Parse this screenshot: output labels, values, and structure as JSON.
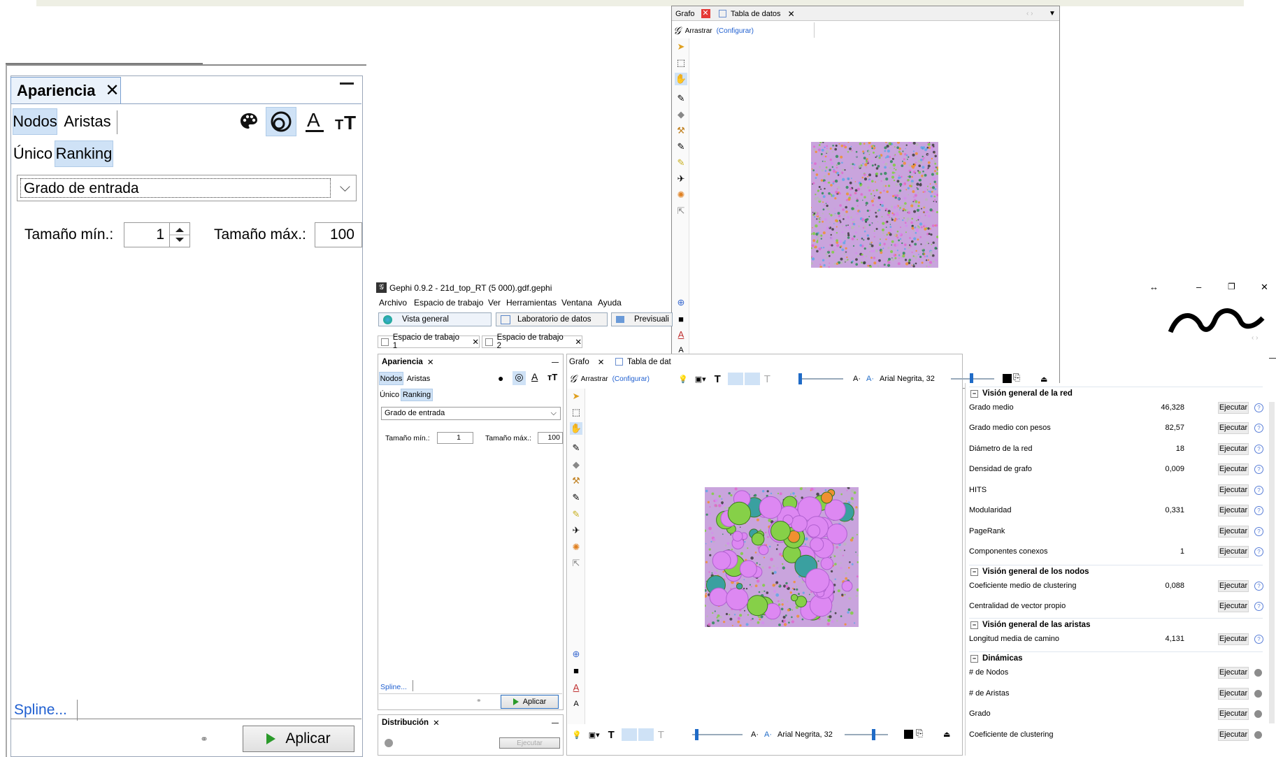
{
  "zoomed_panel": {
    "tab_title": "Apariencia",
    "close": "✕",
    "seg_nodes": "Nodos",
    "seg_edges": "Aristas",
    "mode_unique": "Único",
    "mode_ranking": "Ranking",
    "attribute": "Grado de entrada",
    "min_label": "Tamaño mín.:",
    "min_value": "1",
    "max_label": "Tamaño máx.:",
    "max_value": "100",
    "spline": "Spline...",
    "apply": "Aplicar"
  },
  "float_window": {
    "tab_graph": "Grafo",
    "tab_table": "Tabla de datos",
    "drag_label": "Arrastrar",
    "configure": "(Configurar)"
  },
  "main_window": {
    "title": "Gephi 0.9.2 - 21d_top_RT (5 000).gdf.gephi",
    "menu": [
      "Archivo",
      "Espacio de trabajo",
      "Ver",
      "Herramientas",
      "Ventana",
      "Ayuda"
    ],
    "nav": [
      "Vista general",
      "Laboratorio de datos",
      "Previsuali"
    ],
    "workspaces": [
      "Espacio de trabajo 1",
      "Espacio de trabajo 2"
    ],
    "appearance": {
      "tab_title": "Apariencia",
      "seg_nodes": "Nodos",
      "seg_edges": "Aristas",
      "mode_unique": "Único",
      "mode_ranking": "Ranking",
      "attribute": "Grado de entrada",
      "min_label": "Tamaño mín.:",
      "min_value": "1",
      "max_label": "Tamaño máx.:",
      "max_value": "100",
      "spline": "Spline...",
      "apply": "Aplicar"
    },
    "distribution": {
      "tab_title": "Distribución",
      "run": "Ejecutar"
    },
    "graph_tabs": {
      "graph": "Grafo",
      "table": "Tabla de dat"
    },
    "graph_toolbar": {
      "drag_label": "Arrastrar",
      "configure": "(Configurar)",
      "font": "Arial Negrita, 32"
    },
    "stats": {
      "sections": [
        {
          "title": "Visión general de la red"
        },
        {
          "title": "Visión general de los nodos"
        },
        {
          "title": "Visión general de las aristas"
        },
        {
          "title": "Dinámicas"
        }
      ],
      "run_label": "Ejecutar",
      "rows_network": [
        {
          "name": "Grado medio",
          "value": "46,328"
        },
        {
          "name": "Grado medio con pesos",
          "value": "82,57"
        },
        {
          "name": "Diámetro de la red",
          "value": "18"
        },
        {
          "name": "Densidad de grafo",
          "value": "0,009"
        },
        {
          "name": "HITS",
          "value": ""
        },
        {
          "name": "Modularidad",
          "value": "0,331"
        },
        {
          "name": "PageRank",
          "value": ""
        },
        {
          "name": "Componentes conexos",
          "value": "1"
        }
      ],
      "rows_nodes": [
        {
          "name": "Coeficiente medio de clustering",
          "value": "0,088"
        },
        {
          "name": "Centralidad de vector propio",
          "value": ""
        }
      ],
      "rows_edges": [
        {
          "name": "Longitud media de camino",
          "value": "4,131"
        }
      ],
      "rows_dynamic": [
        {
          "name": "# de Nodos",
          "value": ""
        },
        {
          "name": "# de Aristas",
          "value": ""
        },
        {
          "name": "Grado",
          "value": ""
        },
        {
          "name": "Coeficiente de clustering",
          "value": ""
        }
      ]
    },
    "window_controls": [
      "↔",
      "–",
      "❐",
      "✕"
    ]
  },
  "colors": {
    "accent": "#1f6bc7",
    "selected_seg": "#cfe2f6",
    "node_purple": "#d68cf0",
    "node_green": "#7fcf3f",
    "node_orange": "#f09030"
  }
}
